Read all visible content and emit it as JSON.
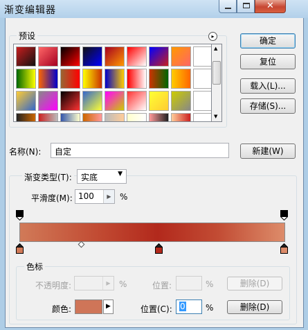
{
  "window": {
    "title": "渐变编辑器",
    "close_glyph": "✕"
  },
  "presets": {
    "label": "预设",
    "menu_glyph": "▸",
    "colors": {
      "swatches": [
        [
          "#c81e1e",
          "#ff6666",
          "#000000",
          "#111111",
          "#a50021",
          "#ff0000",
          "#0000ff",
          "#ff9900",
          "#ffffff"
        ],
        [
          "#006600",
          "#ff6600",
          "#996633",
          "#ffff00",
          "#0000cc",
          "#ff0000",
          "#cc3300",
          "#ffcc00",
          "#ffffff"
        ],
        [
          "#ffcc33",
          "#888888",
          "#000000",
          "#3366cc",
          "#ff00ff",
          "#ff3333",
          "#ffff33",
          "#cccc00",
          "#ffffff"
        ],
        [
          "#222222",
          "#cc2222",
          "#3355aa",
          "#cc6600",
          "#bbbbbb",
          "#ffffcc",
          "#ff9999",
          "#ffcc99",
          "#ffffff"
        ]
      ]
    }
  },
  "buttons": {
    "ok": "确定",
    "reset": "复位",
    "load": "载入(L)...",
    "save": "存储(S)...",
    "new": "新建(W)"
  },
  "name": {
    "label": "名称(N):",
    "value": "自定"
  },
  "gradient": {
    "type_label": "渐变类型(T):",
    "type_value": "实底",
    "smooth_label": "平滑度(M):",
    "smooth_value": "100",
    "smooth_unit": "%",
    "colors": {
      "left": "#d17a58",
      "mid": "#b2291c",
      "right": "#dd8c6a"
    }
  },
  "stops": {
    "label": "色标",
    "opacity_label": "不透明度:",
    "opacity_unit": "%",
    "opacity_pos_label": "位置:",
    "opacity_pos_unit": "%",
    "delete_label": "删除(D)",
    "color_label": "颜色:",
    "color_value": "#cf7558",
    "color_pos_label": "位置(C):",
    "color_pos_value": "0",
    "color_pos_unit": "%",
    "color_delete_label": "删除(D)"
  }
}
